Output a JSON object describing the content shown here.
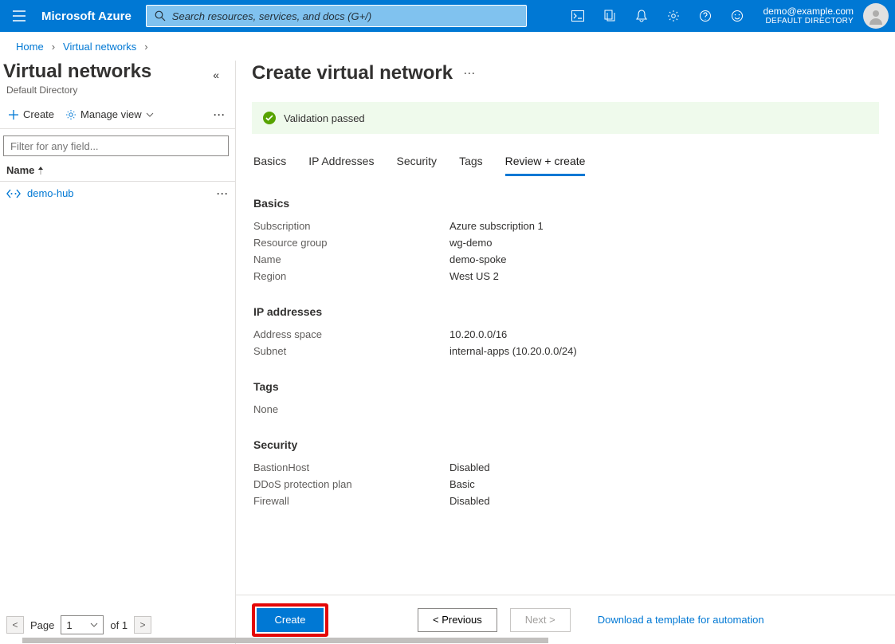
{
  "header": {
    "brand": "Microsoft Azure",
    "search_placeholder": "Search resources, services, and docs (G+/)",
    "account_email": "demo@example.com",
    "account_dir": "DEFAULT DIRECTORY"
  },
  "breadcrumbs": {
    "home": "Home",
    "vnets": "Virtual networks"
  },
  "left": {
    "title": "Virtual networks",
    "subtitle": "Default Directory",
    "create": "Create",
    "manage_view": "Manage view",
    "filter_placeholder": "Filter for any field...",
    "col_name": "Name",
    "items": [
      {
        "name": "demo-hub"
      }
    ],
    "pager_label_page": "Page",
    "pager_page": "1",
    "pager_of": "of 1"
  },
  "right": {
    "title": "Create virtual network",
    "validation_msg": "Validation passed",
    "tabs": {
      "basics": "Basics",
      "ip": "IP Addresses",
      "security": "Security",
      "tags": "Tags",
      "review": "Review + create"
    },
    "sections": {
      "basics": {
        "heading": "Basics",
        "rows": {
          "subscription_k": "Subscription",
          "subscription_v": "Azure subscription 1",
          "rg_k": "Resource group",
          "rg_v": "wg-demo",
          "name_k": "Name",
          "name_v": "demo-spoke",
          "region_k": "Region",
          "region_v": "West US 2"
        }
      },
      "ip": {
        "heading": "IP addresses",
        "rows": {
          "space_k": "Address space",
          "space_v": "10.20.0.0/16",
          "subnet_k": "Subnet",
          "subnet_v": "internal-apps (10.20.0.0/24)"
        }
      },
      "tags": {
        "heading": "Tags",
        "none": "None"
      },
      "security": {
        "heading": "Security",
        "rows": {
          "bastion_k": "BastionHost",
          "bastion_v": "Disabled",
          "ddos_k": "DDoS protection plan",
          "ddos_v": "Basic",
          "fw_k": "Firewall",
          "fw_v": "Disabled"
        }
      }
    },
    "footer": {
      "create": "Create",
      "previous": "< Previous",
      "next": "Next >",
      "download": "Download a template for automation"
    }
  }
}
